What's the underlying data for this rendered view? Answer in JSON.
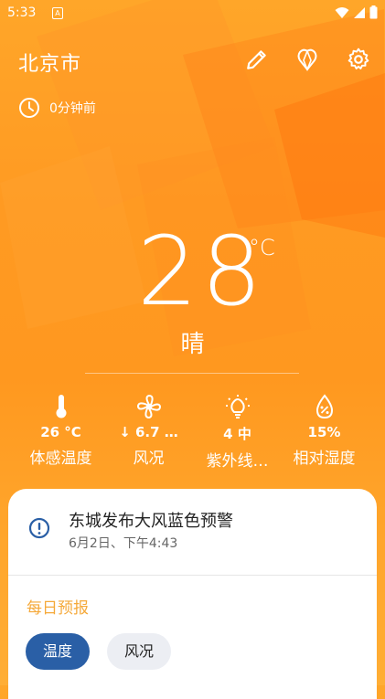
{
  "status": {
    "time": "5:33",
    "a_icon": "A"
  },
  "header": {
    "city": "北京市"
  },
  "updated": {
    "text": "0分钟前"
  },
  "current": {
    "temperature": "28",
    "unit": "°C",
    "condition": "晴"
  },
  "stats": [
    {
      "icon": "thermometer-icon",
      "value": "26 °C",
      "label": "体感温度"
    },
    {
      "icon": "fan-icon",
      "value": "↓ 6.7 …",
      "label": "风况"
    },
    {
      "icon": "lightbulb-icon",
      "value": "4 中",
      "label": "紫外线…"
    },
    {
      "icon": "humidity-drop-icon",
      "value": "15%",
      "label": "相对湿度"
    }
  ],
  "alert": {
    "title": "东城发布大风蓝色预警",
    "time": "6月2日、下午4:43"
  },
  "forecast": {
    "title": "每日预报",
    "tabs": [
      "温度",
      "风况"
    ]
  },
  "colors": {
    "accent": "#2a5fa6",
    "forecast_title": "#f5a93a",
    "background": "#ff9a22"
  }
}
